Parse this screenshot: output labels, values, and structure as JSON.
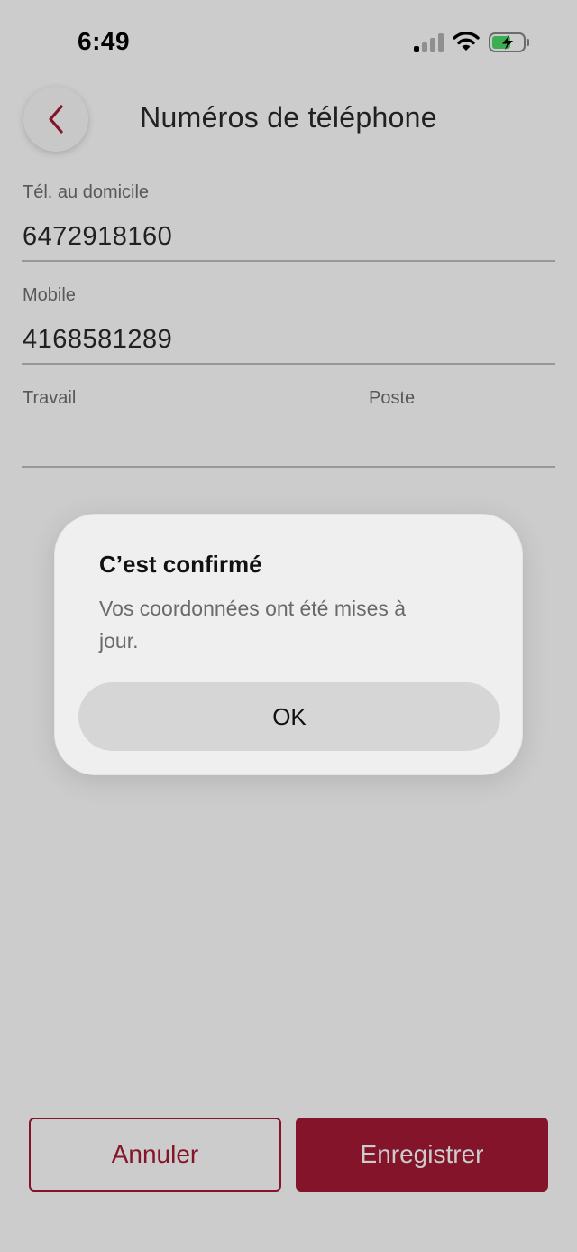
{
  "status_bar": {
    "time": "6:49",
    "signal_bars_active": 1,
    "signal_bars_total": 4,
    "battery_charging": true
  },
  "header": {
    "title": "Numéros de téléphone",
    "back_icon": "chevron-left-icon"
  },
  "fields": {
    "home": {
      "label": "Tél. au domicile",
      "value": "6472918160"
    },
    "mobile": {
      "label": "Mobile",
      "value": "4168581289"
    },
    "work": {
      "label": "Travail",
      "value": "",
      "extension_label": "Poste",
      "extension_value": ""
    }
  },
  "actions": {
    "cancel_label": "Annuler",
    "save_label": "Enregistrer"
  },
  "dialog": {
    "title": "C’est confirmé",
    "message": "Vos coordonnées ont été mises à jour.",
    "ok_label": "OK"
  },
  "colors": {
    "brand": "#a41a34",
    "battery_fill": "#4cd964"
  }
}
